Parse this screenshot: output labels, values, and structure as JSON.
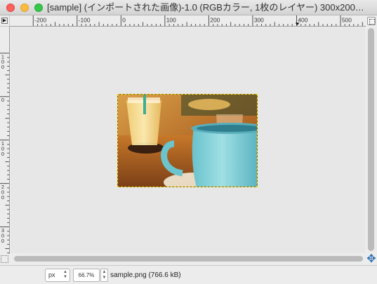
{
  "window": {
    "title": "[sample] (インポートされた画像)-1.0 (RGBカラー, 1枚のレイヤー) 300x200…"
  },
  "rulers": {
    "horizontal_labels": [
      "-200",
      "-100",
      "0",
      "100",
      "200",
      "300",
      "400",
      "500"
    ],
    "vertical_labels": [
      "1\n0\n0",
      "0",
      "1\n0\n0",
      "2\n0\n0",
      "3\n0\n0"
    ]
  },
  "icons": {
    "ruler_corner": "▶",
    "navigate": "✥"
  },
  "statusbar": {
    "unit": "px",
    "zoom": "66.7%",
    "file_info": "sample.png (766.6 kB)"
  },
  "colors": {
    "close": "#fc605c",
    "minimize": "#fdbc40",
    "maximize": "#34c84a",
    "selection_dash": "#e3d600"
  }
}
